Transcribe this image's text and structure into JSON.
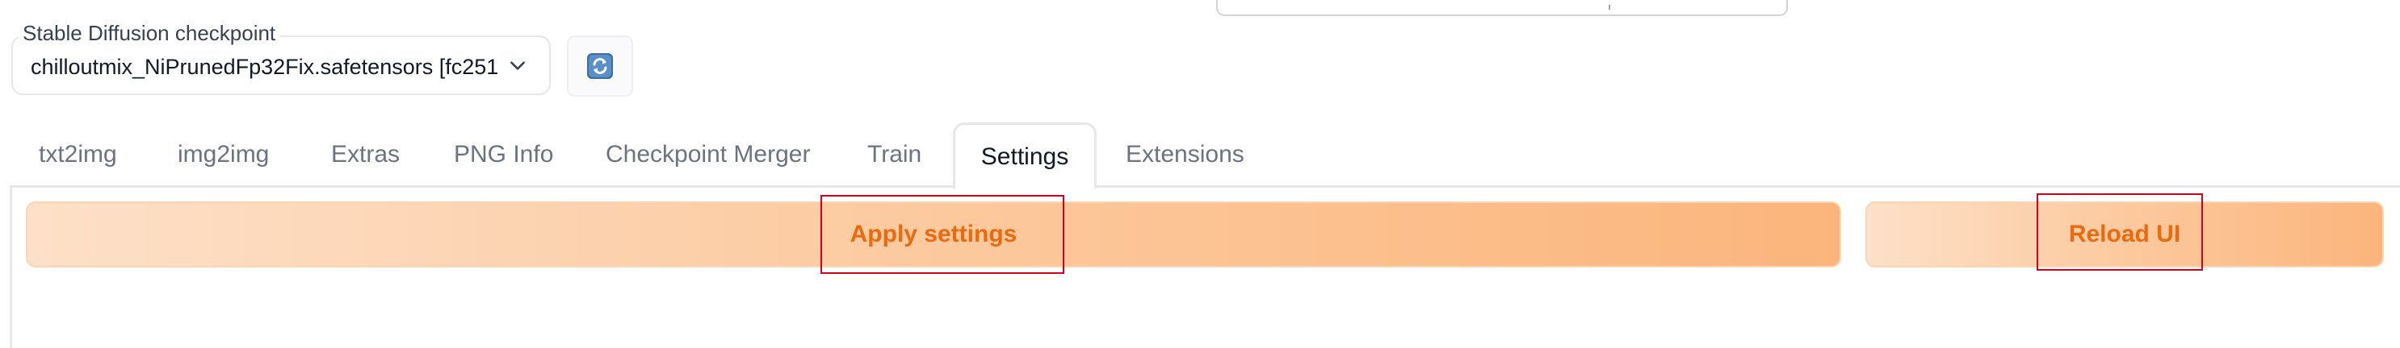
{
  "checkpoint": {
    "label": "Stable Diffusion checkpoint",
    "value": "chilloutmix_NiPrunedFp32Fix.safetensors [fc251",
    "dropdown_icon": "chevron-down-icon",
    "refresh_icon": "refresh-icon"
  },
  "tabs": [
    {
      "label": "txt2img"
    },
    {
      "label": "img2img"
    },
    {
      "label": "Extras"
    },
    {
      "label": "PNG Info"
    },
    {
      "label": "Checkpoint Merger"
    },
    {
      "label": "Train"
    },
    {
      "label": "Settings"
    },
    {
      "label": "Extensions"
    }
  ],
  "active_tab": "Settings",
  "actions": {
    "apply_label": "Apply settings",
    "reload_label": "Reload UI"
  },
  "colors": {
    "accent_text": "#ea6a10",
    "button_gradient_start": "#fde0c8",
    "button_gradient_end": "#fbb57c",
    "highlight": "#d0021b"
  }
}
